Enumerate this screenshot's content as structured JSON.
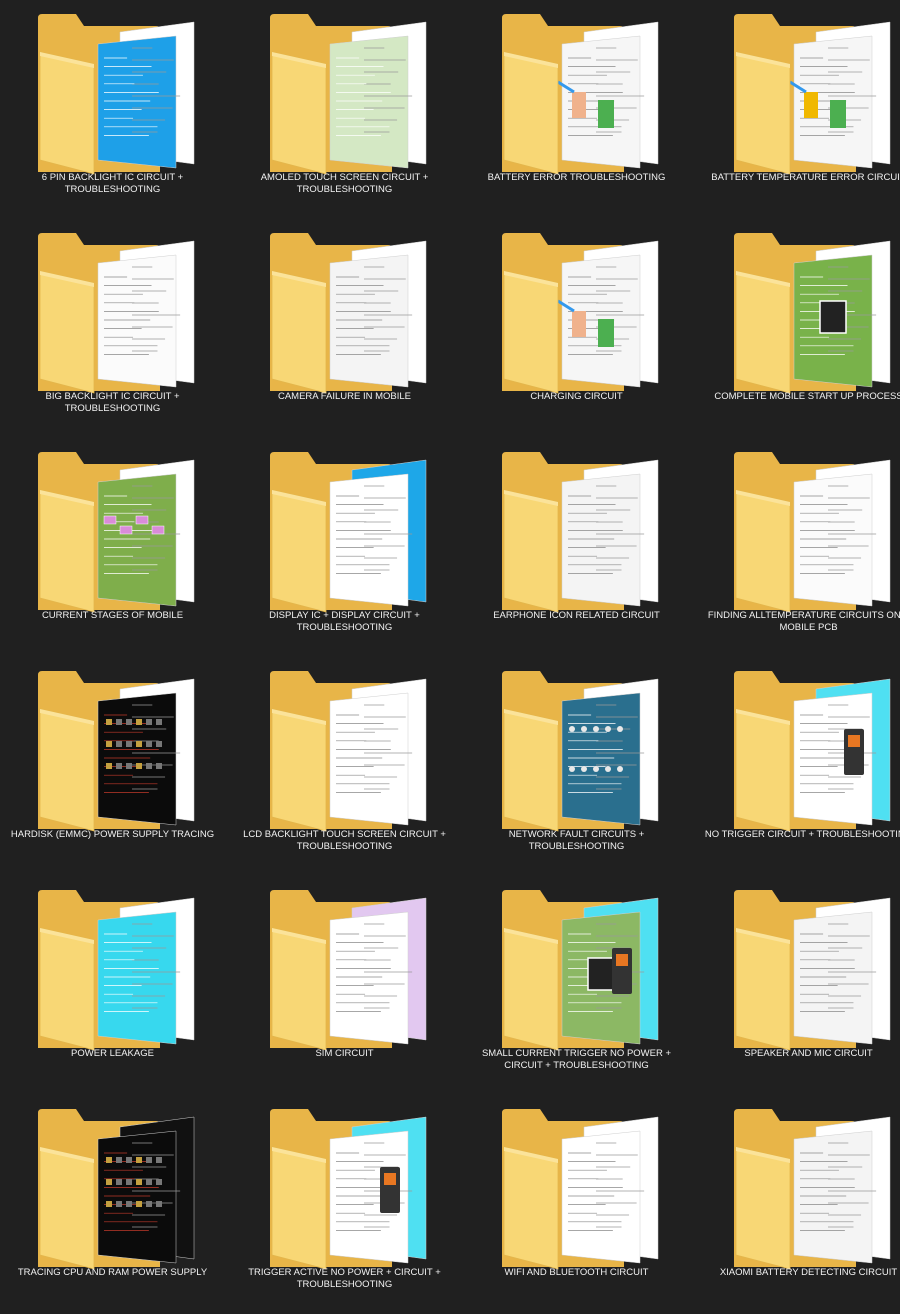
{
  "folders": [
    {
      "label": "6 PIN BACKLIGHT IC CIRCUIT + TROUBLESHOOTING",
      "thumb": "blue-doc",
      "icon": "folder-icon"
    },
    {
      "label": "AMOLED TOUCH SCREEN CIRCUIT + TROUBLESHOOTING",
      "thumb": "green-schematic",
      "icon": "folder-icon"
    },
    {
      "label": "BATTERY ERROR TROUBLESHOOTING",
      "thumb": "white-diagram",
      "icon": "folder-icon"
    },
    {
      "label": "BATTERY TEMPERATURE ERROR CIRCUIT",
      "thumb": "white-diagram-orange",
      "icon": "folder-icon"
    },
    {
      "label": "BIG BACKLIGHT IC CIRCUIT + TROUBLESHOOTING",
      "thumb": "white-text",
      "icon": "folder-icon"
    },
    {
      "label": "CAMERA FAILURE IN MOBILE",
      "thumb": "white-schematic",
      "icon": "folder-icon"
    },
    {
      "label": "CHARGING CIRCUIT",
      "thumb": "white-diagram",
      "icon": "folder-icon"
    },
    {
      "label": "COMPLETE MOBILE START UP PROCESS",
      "thumb": "green-board",
      "icon": "folder-icon"
    },
    {
      "label": "CURRENT STAGES OF MOBILE",
      "thumb": "green-flow",
      "icon": "folder-icon"
    },
    {
      "label": "DISPLAY IC + DISPLAY CIRCUIT + TROUBLESHOOTING",
      "thumb": "blue-schematic",
      "icon": "folder-icon"
    },
    {
      "label": "EARPHONE ICON RELATED CIRCUIT",
      "thumb": "white-schematic",
      "icon": "folder-icon"
    },
    {
      "label": "FINDING  ALLTEMPERATURE CIRCUITS ON A MOBILE PCB",
      "thumb": "white-text",
      "icon": "folder-icon"
    },
    {
      "label": "HARDISK (EMMC) POWER SUPPLY TRACING",
      "thumb": "dark-pcb",
      "icon": "folder-icon"
    },
    {
      "label": "LCD BACKLIGHT TOUCH SCREEN CIRCUIT + TROUBLESHOOTING",
      "thumb": "white-lcd",
      "icon": "folder-icon"
    },
    {
      "label": "NETWORK FAULT CIRCUITS + TROUBLESHOOTING",
      "thumb": "blue-pcb",
      "icon": "folder-icon"
    },
    {
      "label": "NO TRIGGER CIRCUIT + TROUBLESHOOTING",
      "thumb": "cyan-device",
      "icon": "folder-icon"
    },
    {
      "label": "POWER LEAKAGE",
      "thumb": "cyan-flow",
      "icon": "folder-icon"
    },
    {
      "label": "SIM CIRCUIT",
      "thumb": "purple-schematic",
      "icon": "folder-icon"
    },
    {
      "label": "SMALL CURRENT TRIGGER NO POWER  + CIRCUIT + TROUBLESHOOTING",
      "thumb": "green-device",
      "icon": "folder-icon"
    },
    {
      "label": "SPEAKER AND MIC CIRCUIT",
      "thumb": "white-schematic",
      "icon": "folder-icon"
    },
    {
      "label": "TRACING CPU AND RAM POWER SUPPLY",
      "thumb": "dark-pcb-dots",
      "icon": "folder-icon"
    },
    {
      "label": "TRIGGER ACTIVE NO POWER  + CIRCUIT + TROUBLESHOOTING",
      "thumb": "cyan-device",
      "icon": "folder-icon"
    },
    {
      "label": "WIFI AND BLUETOOTH CIRCUIT",
      "thumb": "white-dense",
      "icon": "folder-icon"
    },
    {
      "label": "XIAOMI BATTERY DETECTING CIRCUIT",
      "thumb": "white-schematic",
      "icon": "folder-icon"
    }
  ],
  "colors": {
    "background": "#202020",
    "folder_back": "#E8B548",
    "folder_front": "#F8D775",
    "label_text": "#F2F2F2"
  }
}
